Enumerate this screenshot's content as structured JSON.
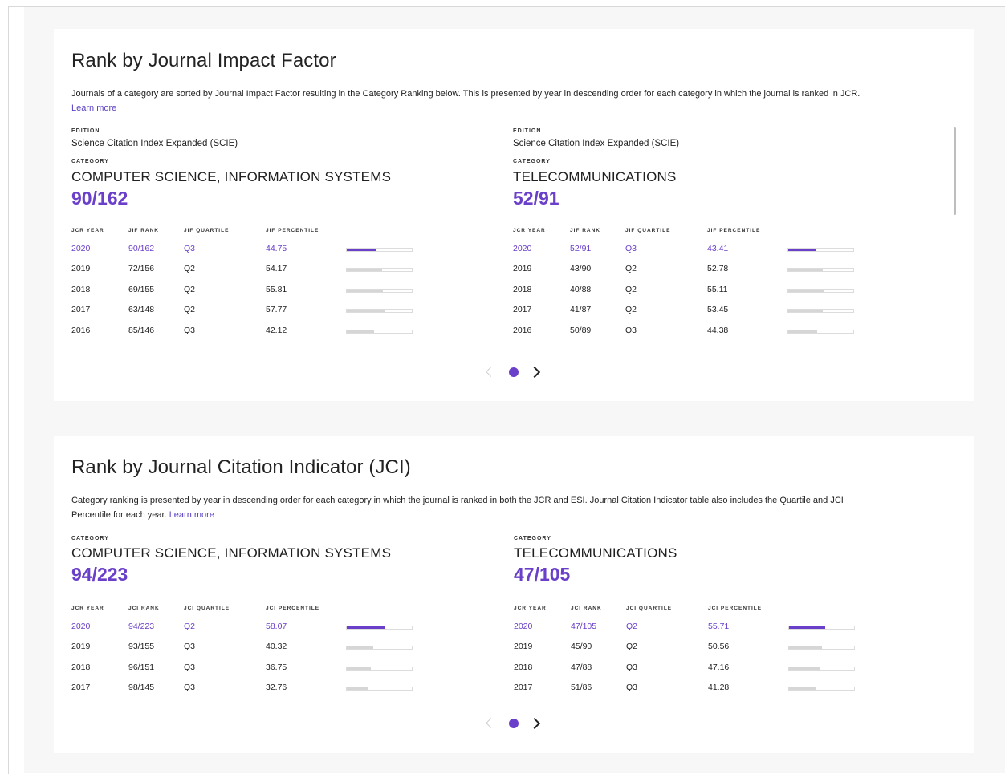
{
  "jif": {
    "title": "Rank by Journal Impact Factor",
    "description": "Journals of a category are sorted by Journal Impact Factor resulting in the Category Ranking below. This is presented by year in descending order for each category in which the journal is ranked in JCR.",
    "learn_more": "Learn more",
    "headers": [
      "JCR YEAR",
      "JIF RANK",
      "JIF QUARTILE",
      "JIF PERCENTILE"
    ],
    "categories": [
      {
        "edition_label": "EDITION",
        "edition": "Science Citation Index Expanded (SCIE)",
        "category_label": "CATEGORY",
        "name": "COMPUTER SCIENCE, INFORMATION SYSTEMS",
        "rank": "90/162",
        "rows": [
          {
            "year": "2020",
            "rank": "90/162",
            "quartile": "Q3",
            "percentile": "44.75",
            "pct": 44.75
          },
          {
            "year": "2019",
            "rank": "72/156",
            "quartile": "Q2",
            "percentile": "54.17",
            "pct": 54.17
          },
          {
            "year": "2018",
            "rank": "69/155",
            "quartile": "Q2",
            "percentile": "55.81",
            "pct": 55.81
          },
          {
            "year": "2017",
            "rank": "63/148",
            "quartile": "Q2",
            "percentile": "57.77",
            "pct": 57.77
          },
          {
            "year": "2016",
            "rank": "85/146",
            "quartile": "Q3",
            "percentile": "42.12",
            "pct": 42.12
          }
        ]
      },
      {
        "edition_label": "EDITION",
        "edition": "Science Citation Index Expanded (SCIE)",
        "category_label": "CATEGORY",
        "name": "TELECOMMUNICATIONS",
        "rank": "52/91",
        "rows": [
          {
            "year": "2020",
            "rank": "52/91",
            "quartile": "Q3",
            "percentile": "43.41",
            "pct": 43.41
          },
          {
            "year": "2019",
            "rank": "43/90",
            "quartile": "Q2",
            "percentile": "52.78",
            "pct": 52.78
          },
          {
            "year": "2018",
            "rank": "40/88",
            "quartile": "Q2",
            "percentile": "55.11",
            "pct": 55.11
          },
          {
            "year": "2017",
            "rank": "41/87",
            "quartile": "Q2",
            "percentile": "53.45",
            "pct": 53.45
          },
          {
            "year": "2016",
            "rank": "50/89",
            "quartile": "Q3",
            "percentile": "44.38",
            "pct": 44.38
          }
        ]
      }
    ]
  },
  "jci": {
    "title": "Rank by Journal Citation Indicator (JCI)",
    "description_line1": "Category ranking is presented by year in descending order for each category in which the journal is ranked in both the JCR and ESI. Journal Citation Indicator table also includes the Quartile and JCI",
    "description_line2": "Percentile for each year.",
    "learn_more": "Learn more",
    "headers": [
      "JCR YEAR",
      "JCI RANK",
      "JCI QUARTILE",
      "JCI PERCENTILE"
    ],
    "categories": [
      {
        "category_label": "CATEGORY",
        "name": "COMPUTER SCIENCE, INFORMATION SYSTEMS",
        "rank": "94/223",
        "rows": [
          {
            "year": "2020",
            "rank": "94/223",
            "quartile": "Q2",
            "percentile": "58.07",
            "pct": 58.07
          },
          {
            "year": "2019",
            "rank": "93/155",
            "quartile": "Q3",
            "percentile": "40.32",
            "pct": 40.32
          },
          {
            "year": "2018",
            "rank": "96/151",
            "quartile": "Q3",
            "percentile": "36.75",
            "pct": 36.75
          },
          {
            "year": "2017",
            "rank": "98/145",
            "quartile": "Q3",
            "percentile": "32.76",
            "pct": 32.76
          }
        ]
      },
      {
        "category_label": "CATEGORY",
        "name": "TELECOMMUNICATIONS",
        "rank": "47/105",
        "rows": [
          {
            "year": "2020",
            "rank": "47/105",
            "quartile": "Q2",
            "percentile": "55.71",
            "pct": 55.71
          },
          {
            "year": "2019",
            "rank": "45/90",
            "quartile": "Q2",
            "percentile": "50.56",
            "pct": 50.56
          },
          {
            "year": "2018",
            "rank": "47/88",
            "quartile": "Q3",
            "percentile": "47.16",
            "pct": 47.16
          },
          {
            "year": "2017",
            "rank": "51/86",
            "quartile": "Q3",
            "percentile": "41.28",
            "pct": 41.28
          }
        ]
      }
    ]
  },
  "pager": {
    "prev_icon": "chevron-left-icon",
    "dot_icon": "page-dot-icon",
    "next_icon": "chevron-right-icon"
  },
  "colors": {
    "accent": "#6a3fc9",
    "bar_inactive": "#d6d6d6"
  }
}
